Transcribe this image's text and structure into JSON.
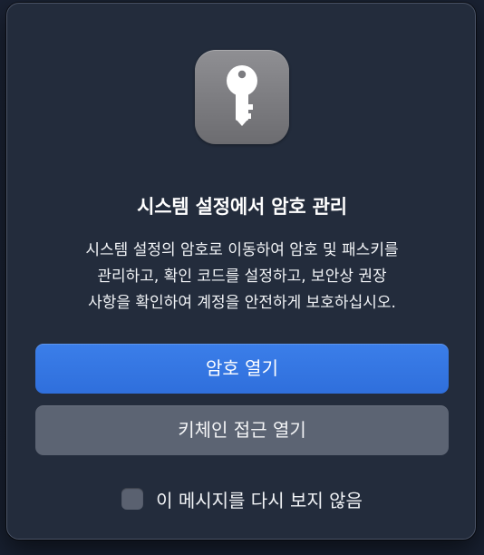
{
  "dialog": {
    "title": "시스템 설정에서 암호 관리",
    "message_lines": [
      "시스템 설정의 암호로 이동하여 암호 및 패스키를",
      "관리하고, 확인 코드를 설정하고, 보안상 권장",
      "사항을 확인하여 계정을 안전하게 보호하십시오."
    ],
    "primary_button_label": "암호 열기",
    "secondary_button_label": "키체인 접근 열기",
    "checkbox_label": "이 메시지를 다시 보지 않음",
    "checkbox_checked": false
  },
  "icon": {
    "name": "key-icon",
    "background_color": "#7f7f83"
  },
  "colors": {
    "primary_button": "#3577e3",
    "secondary_button": "#5c6473",
    "dialog_background": "#232c3c"
  }
}
